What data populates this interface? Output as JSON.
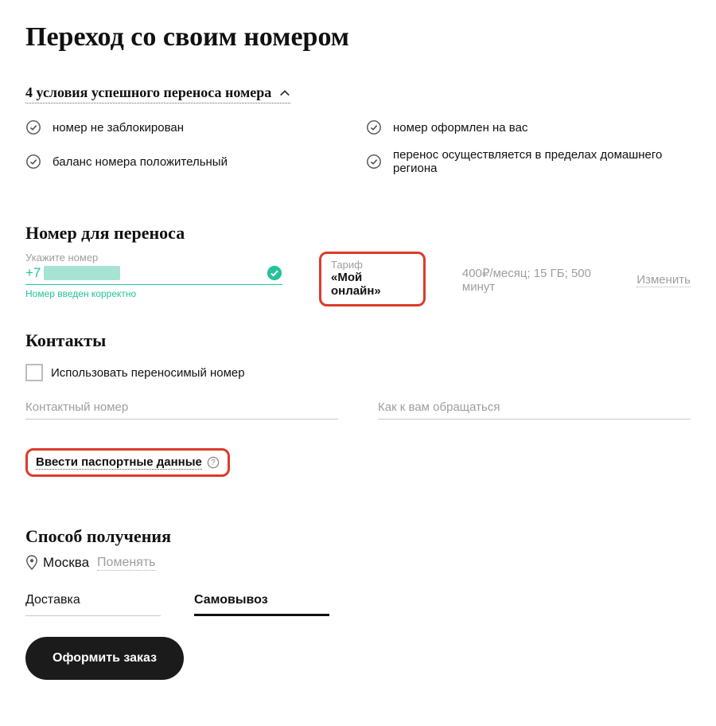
{
  "page_title": "Переход со своим номером",
  "accordion": {
    "title": "4 условия успешного переноса номера",
    "items": [
      "номер не заблокирован",
      "номер оформлен на вас",
      "баланс номера положительный",
      "перенос осуществляется в пределах домашнего региона"
    ]
  },
  "transfer": {
    "heading": "Номер для переноса",
    "field_label": "Укажите номер",
    "prefix": "+7",
    "valid_note": "Номер введен корректно"
  },
  "tariff": {
    "label": "Тариф",
    "name": "«Мой онлайн»",
    "stats": "400₽/месяц; 15 ГБ; 500 минут",
    "change": "Изменить"
  },
  "contacts": {
    "heading": "Контакты",
    "checkbox_label": "Использовать переносимый номер",
    "phone_placeholder": "Контактный номер",
    "name_placeholder": "Как к вам обращаться"
  },
  "passport": {
    "label": "Ввести паспортные данные"
  },
  "delivery": {
    "heading": "Способ получения",
    "city": "Москва",
    "change": "Поменять",
    "tabs": [
      "Доставка",
      "Самовывоз"
    ],
    "active_tab": 1
  },
  "submit_label": "Оформить заказ"
}
